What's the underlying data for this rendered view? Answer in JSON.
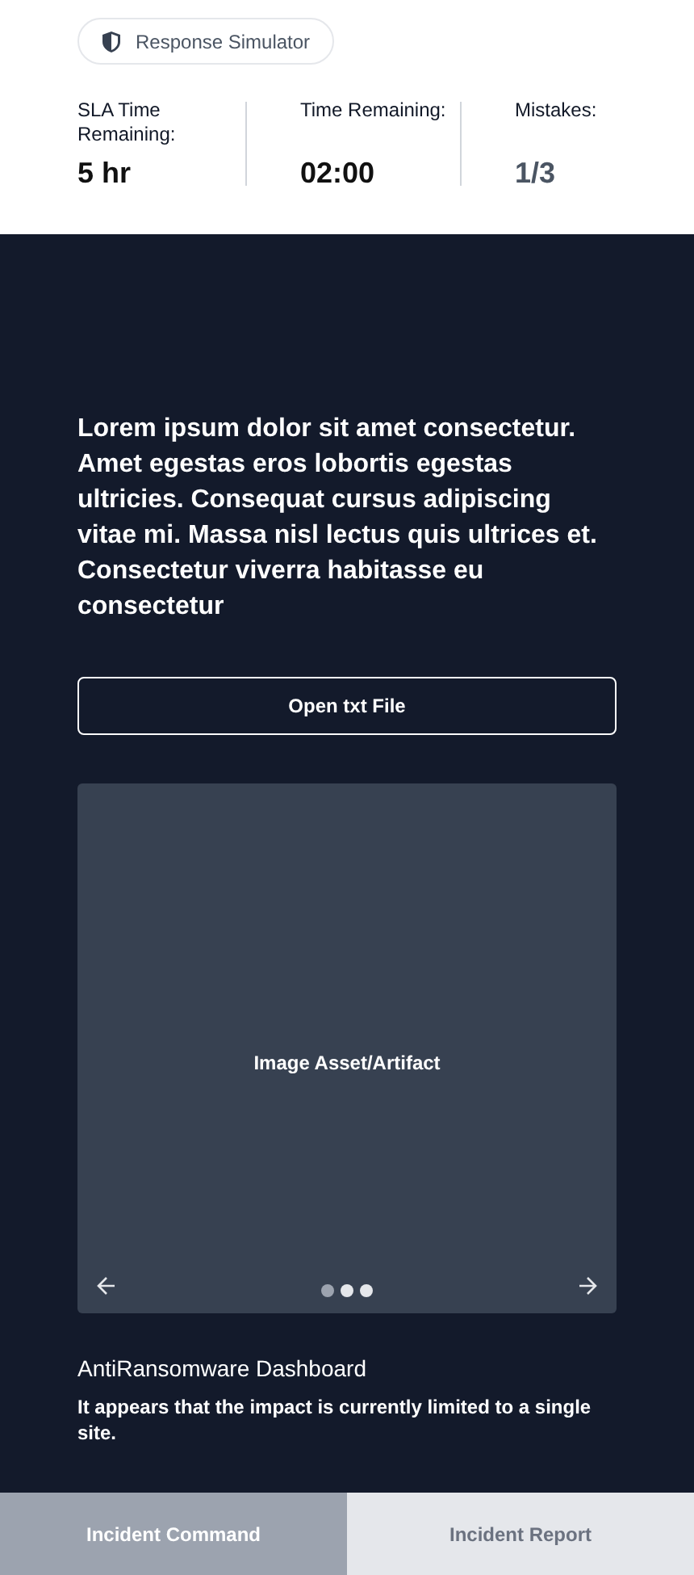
{
  "badge": {
    "label": "Response Simulator"
  },
  "stats": [
    {
      "label": "SLA Time Remaining:",
      "value": "5 hr",
      "kind": "strong"
    },
    {
      "label": "Time Remaining:",
      "value": "02:00",
      "kind": "strong"
    },
    {
      "label": "Mistakes:",
      "value": "1/3",
      "kind": "muted"
    }
  ],
  "prompt": "Lorem ipsum dolor sit amet consectetur. Amet egestas eros lobortis egestas ultricies. Consequat cursus adipiscing vitae mi. Massa nisl lectus quis ultrices et. Consectetur viverra habitasse eu consectetur",
  "open_button": "Open txt File",
  "carousel": {
    "caption": "Image Asset/Artifact",
    "dots": [
      {
        "selected": true
      },
      {
        "selected": false
      },
      {
        "selected": false
      }
    ]
  },
  "artifact": {
    "title": "AntiRansomware Dashboard",
    "description": "It appears that the impact is currently limited to a single site."
  },
  "tabs": [
    {
      "label": "Incident Command",
      "selected": true
    },
    {
      "label": "Incident Report",
      "selected": false
    }
  ]
}
